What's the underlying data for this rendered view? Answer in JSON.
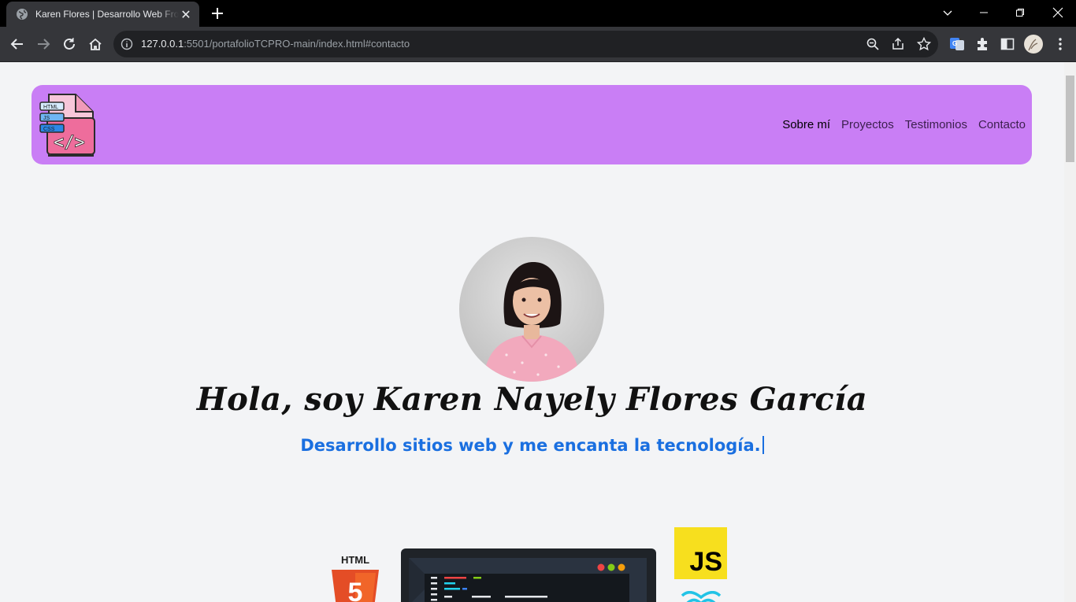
{
  "browser": {
    "tab_title": "Karen Flores | Desarrollo Web Front-End",
    "url_host": "127.0.0.1",
    "url_rest": ":5501/portafolioTCPRO-main/index.html#contacto"
  },
  "nav": {
    "links": [
      {
        "label": "Sobre mí"
      },
      {
        "label": "Proyectos"
      },
      {
        "label": "Testimonios"
      },
      {
        "label": "Contacto"
      }
    ]
  },
  "logo": {
    "badges": [
      "HTML",
      "JS",
      "CSS"
    ],
    "code_glyph": "</>"
  },
  "hero": {
    "greeting": "Hola, soy Karen Nayely Flores García",
    "tagline": "Desarrollo sitios web y me encanta la tecnología."
  },
  "tech": {
    "html_label": "HTML",
    "html_glyph": "5",
    "js_label": "JS"
  },
  "colors": {
    "navbar": "#c97ef5",
    "tagline": "#1a6fe0",
    "page_bg": "#f3f4f6"
  }
}
